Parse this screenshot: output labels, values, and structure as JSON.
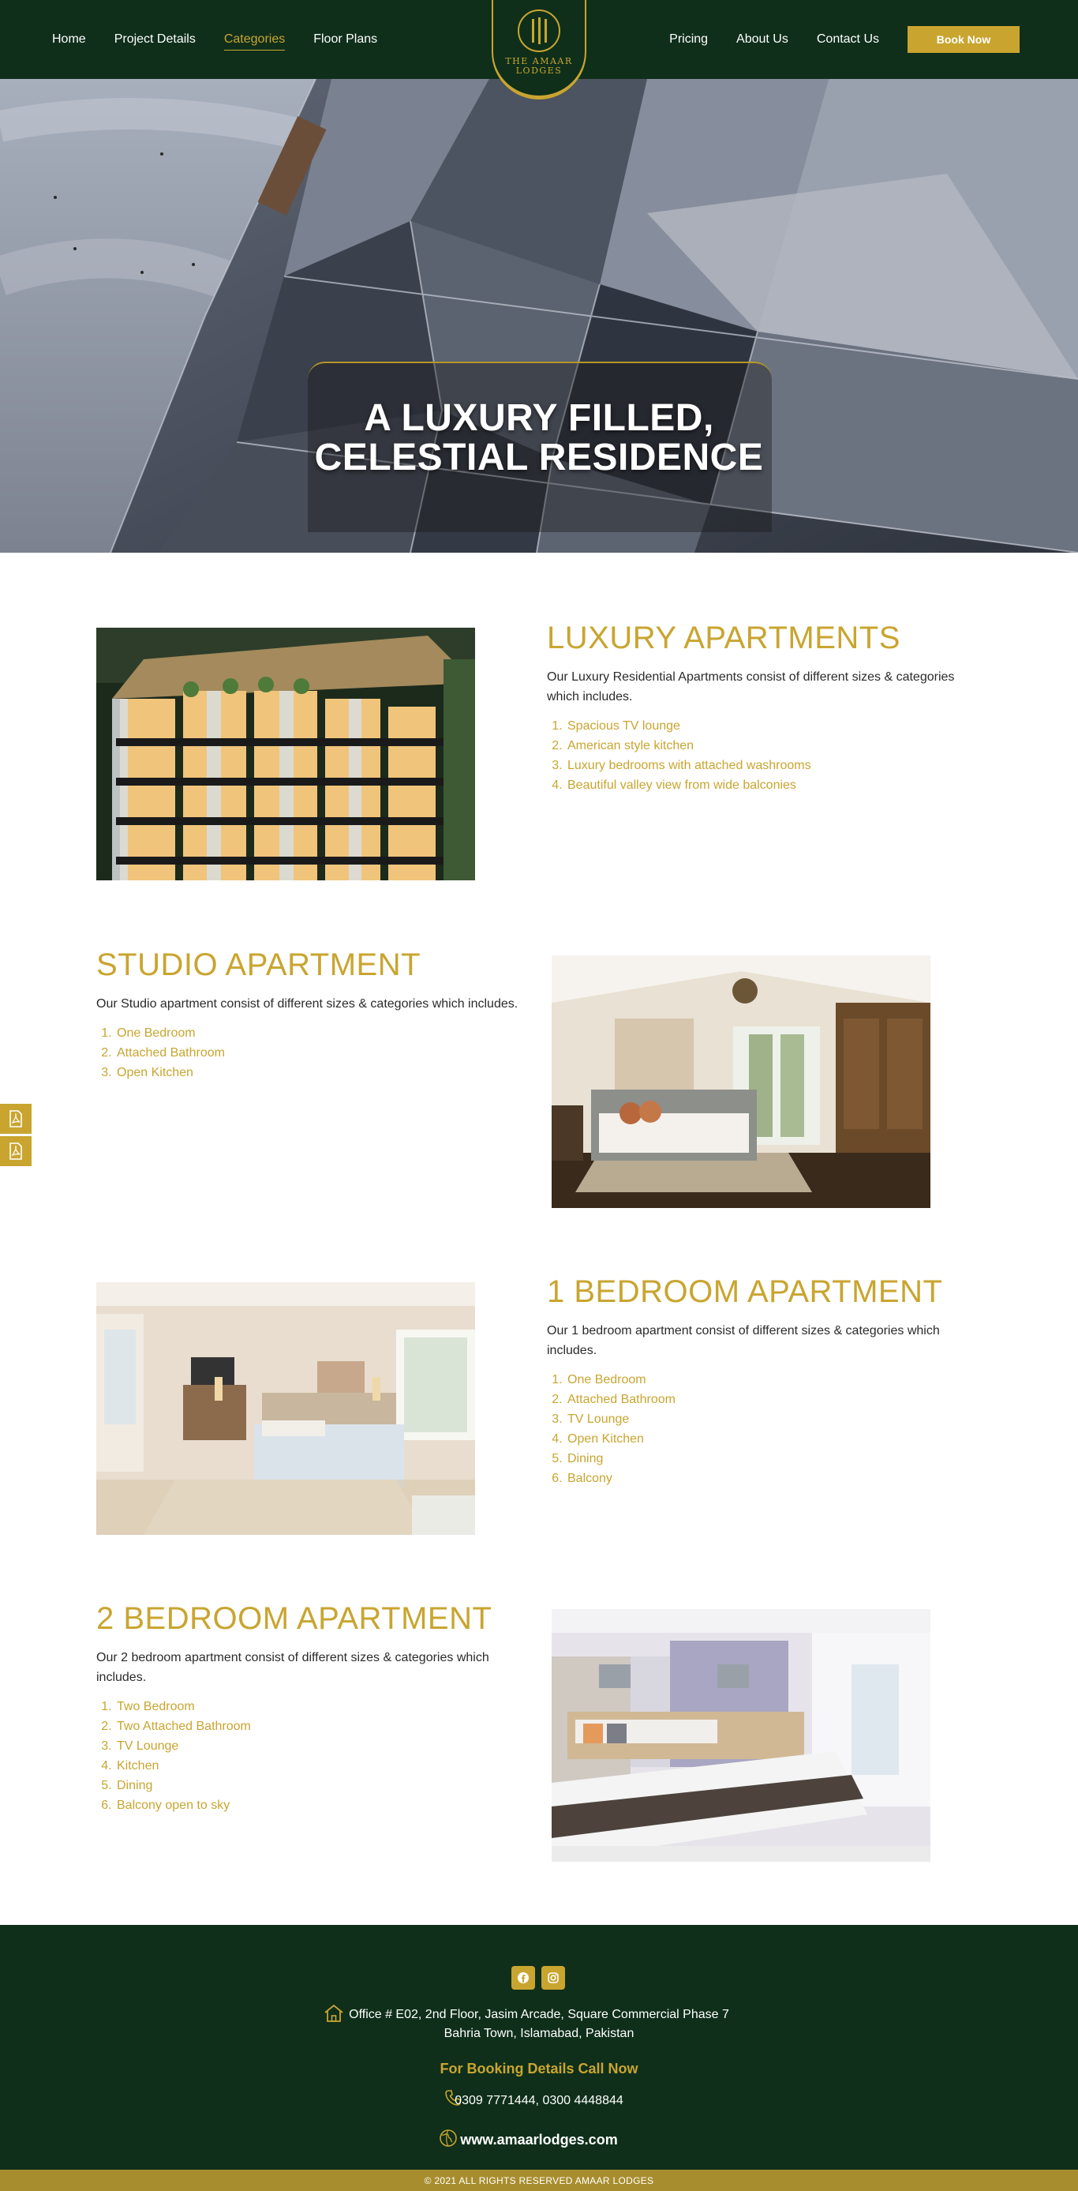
{
  "header": {
    "nav_left": [
      "Home",
      "Project Details",
      "Categories",
      "Floor Plans"
    ],
    "nav_right": [
      "Pricing",
      "About Us",
      "Contact Us"
    ],
    "active_item": "Categories",
    "book_button": "Book Now",
    "logo_line1": "THE AMAAR",
    "logo_line2": "LODGES"
  },
  "hero": {
    "title_line1": "A LUXURY FILLED,",
    "title_line2": "CELESTIAL RESIDENCE"
  },
  "sections": [
    {
      "title": "LUXURY APARTMENTS",
      "description": "Our Luxury Residential Apartments consist of different sizes & categories which includes.",
      "items": [
        "Spacious TV lounge",
        "American style kitchen",
        "Luxury bedrooms with  attached washrooms",
        "Beautiful valley view from wide balconies"
      ]
    },
    {
      "title": "STUDIO APARTMENT",
      "description": "Our Studio apartment consist of different sizes & categories which includes.",
      "items": [
        "One Bedroom",
        "Attached Bathroom",
        "Open Kitchen"
      ]
    },
    {
      "title": "1 BEDROOM APARTMENT",
      "description": "Our 1 bedroom apartment consist of different sizes & categories which includes.",
      "items": [
        "One Bedroom",
        "Attached Bathroom",
        "TV Lounge",
        "Open Kitchen",
        "Dining",
        "Balcony"
      ]
    },
    {
      "title": "2 BEDROOM APARTMENT",
      "description": "Our 2 bedroom apartment consist of different sizes & categories which includes.",
      "items": [
        "Two Bedroom",
        "Two Attached Bathroom",
        "TV Lounge",
        "Kitchen",
        "Dining",
        "Balcony open to sky"
      ]
    }
  ],
  "footer": {
    "social_icons": [
      "facebook-icon",
      "instagram-icon"
    ],
    "address_line1": "Office # E02, 2nd Floor, Jasim Arcade, Square Commercial Phase 7",
    "address_line2": "Bahria Town, Islamabad, Pakistan",
    "booking_heading": "For Booking Details Call Now",
    "phones": "0309 7771444, 0300 4448844",
    "website": "www.amaarlodges.com",
    "copyright": "© 2021 ALL RIGHTS RESERVED   AMAAR LODGES"
  },
  "colors": {
    "dark_green": "#0f2f1a",
    "gold": "#c9a530",
    "gold_bar": "#a88d2e"
  }
}
